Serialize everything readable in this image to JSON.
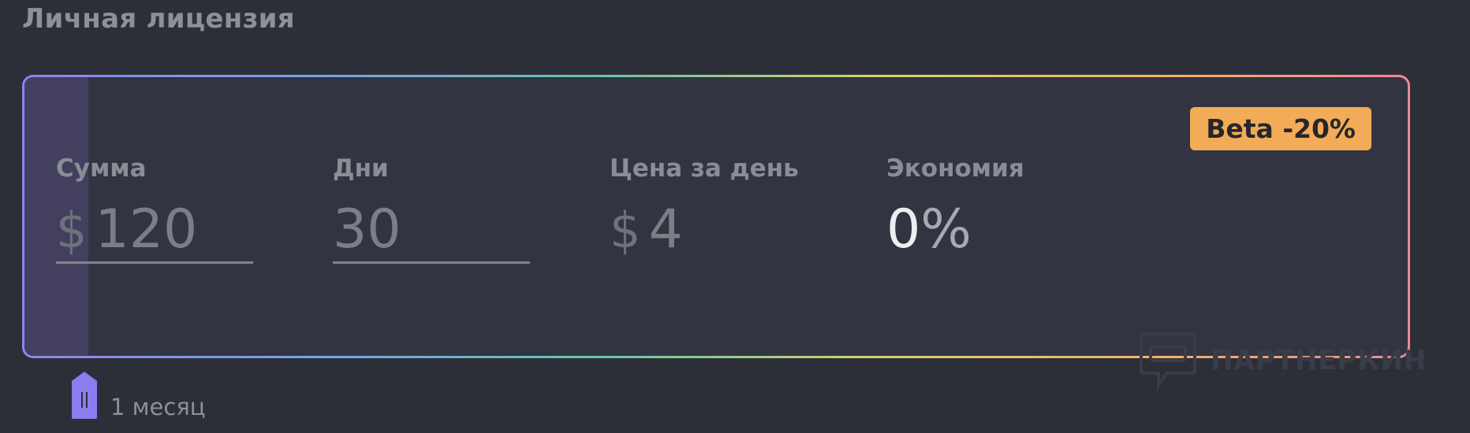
{
  "section_title": "Личная лицензия",
  "badge": "Beta -20%",
  "metrics": [
    {
      "label": "Сумма",
      "currency": "$",
      "value": "120"
    },
    {
      "label": "Дни",
      "value": "30"
    },
    {
      "label": "Цена за день",
      "currency": "$",
      "value": "4"
    },
    {
      "label": "Экономия",
      "value": "0",
      "suffix": "%"
    }
  ],
  "slider": {
    "label": "1 месяц",
    "fill_fraction": 0.046
  },
  "watermark": "ПАРТНЕРКИН",
  "colors": {
    "background": "#2c2f38",
    "card": "#323541",
    "accent": "#8f83f0",
    "badge": "#f2ab57"
  }
}
